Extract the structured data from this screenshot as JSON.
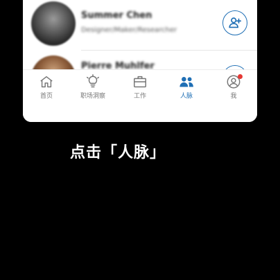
{
  "connections": [
    {
      "name": "Summer Chen",
      "title": "Designer/Maker/Researcher"
    },
    {
      "name": "Pierre Muhlfer",
      "title": ""
    }
  ],
  "tabs": [
    {
      "label": "首页",
      "icon": "home-icon",
      "active": false
    },
    {
      "label": "职场洞察",
      "icon": "lightbulb-icon",
      "active": false
    },
    {
      "label": "工作",
      "icon": "briefcase-icon",
      "active": false
    },
    {
      "label": "人脉",
      "icon": "people-icon",
      "active": true
    },
    {
      "label": "我",
      "icon": "profile-icon",
      "active": false
    }
  ],
  "caption": "点击「人脉」",
  "colors": {
    "accent": "#1f6fb5",
    "badge": "#e53935",
    "background": "#000000"
  }
}
